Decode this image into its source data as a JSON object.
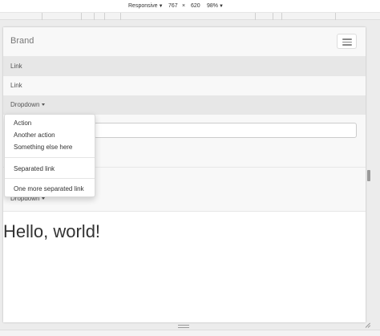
{
  "devtools": {
    "device_label": "Responsive",
    "width": "767",
    "times": "×",
    "height": "620",
    "zoom": "98%"
  },
  "navbar": {
    "brand": "Brand",
    "items": [
      {
        "label": "Link",
        "active": true
      },
      {
        "label": "Link",
        "active": false
      },
      {
        "label": "Dropdown",
        "active": true
      }
    ],
    "second_dropdown_label": "Dropdown"
  },
  "dropdown": {
    "items": [
      "Action",
      "Another action",
      "Something else here",
      "Separated link",
      "One more separated link"
    ]
  },
  "main": {
    "heading": "Hello, world!"
  },
  "colors": {
    "navbar_bg": "#f8f8f8",
    "active_bg": "#e7e7e7",
    "link_text": "#555555"
  }
}
